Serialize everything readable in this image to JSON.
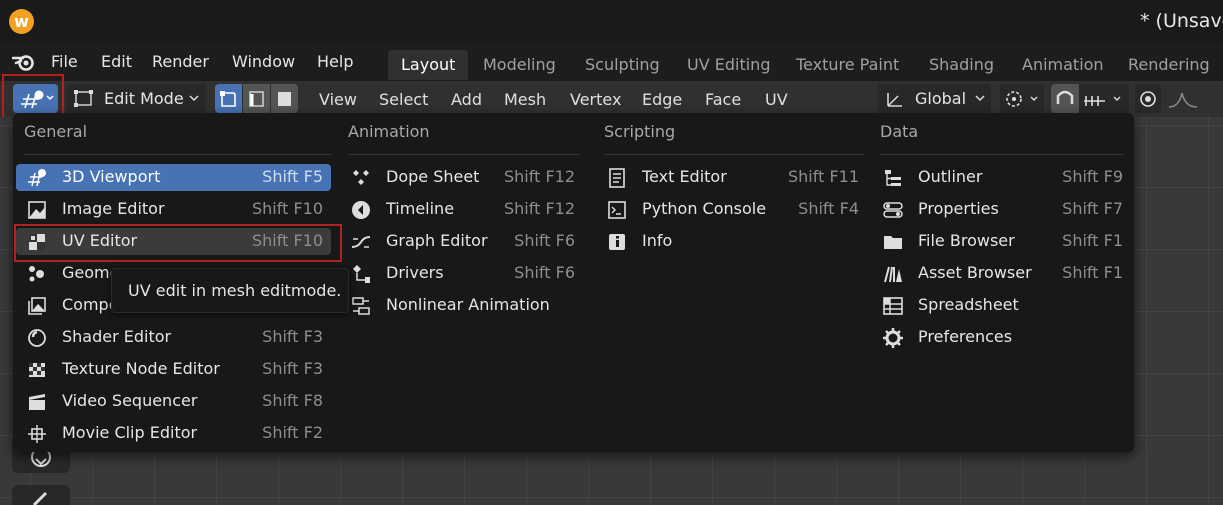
{
  "window": {
    "title": "* (Unsave"
  },
  "menubar": {
    "items": [
      "File",
      "Edit",
      "Render",
      "Window",
      "Help"
    ],
    "workspaces": [
      "Layout",
      "Modeling",
      "Sculpting",
      "UV Editing",
      "Texture Paint",
      "Shading",
      "Animation",
      "Rendering"
    ],
    "active_workspace": "Layout"
  },
  "header": {
    "mode": "Edit Mode",
    "menus": [
      "View",
      "Select",
      "Add",
      "Mesh",
      "Vertex",
      "Edge",
      "Face",
      "UV"
    ],
    "transform_orientation": "Global"
  },
  "editor_menu": {
    "columns": [
      {
        "title": "General",
        "items": [
          {
            "label": "3D Viewport",
            "shortcut": "Shift F5",
            "icon": "3d-viewport-icon",
            "state": "selected"
          },
          {
            "label": "Image Editor",
            "shortcut": "Shift F10",
            "icon": "image-editor-icon"
          },
          {
            "label": "UV Editor",
            "shortcut": "Shift F10",
            "icon": "uv-editor-icon",
            "state": "hover"
          },
          {
            "label": "Geome",
            "shortcut": "",
            "icon": "geometry-node-editor-icon"
          },
          {
            "label": "Compo",
            "shortcut": "",
            "icon": "compositor-icon"
          },
          {
            "label": "Shader Editor",
            "shortcut": "Shift F3",
            "icon": "shader-editor-icon"
          },
          {
            "label": "Texture Node Editor",
            "shortcut": "Shift F3",
            "icon": "texture-node-editor-icon"
          },
          {
            "label": "Video Sequencer",
            "shortcut": "Shift F8",
            "icon": "video-sequencer-icon"
          },
          {
            "label": "Movie Clip Editor",
            "shortcut": "Shift F2",
            "icon": "movie-clip-editor-icon"
          }
        ]
      },
      {
        "title": "Animation",
        "items": [
          {
            "label": "Dope Sheet",
            "shortcut": "Shift F12",
            "icon": "dope-sheet-icon"
          },
          {
            "label": "Timeline",
            "shortcut": "Shift F12",
            "icon": "timeline-icon"
          },
          {
            "label": "Graph Editor",
            "shortcut": "Shift F6",
            "icon": "graph-editor-icon"
          },
          {
            "label": "Drivers",
            "shortcut": "Shift F6",
            "icon": "drivers-icon"
          },
          {
            "label": "Nonlinear Animation",
            "shortcut": "",
            "icon": "nla-icon"
          }
        ]
      },
      {
        "title": "Scripting",
        "items": [
          {
            "label": "Text Editor",
            "shortcut": "Shift F11",
            "icon": "text-editor-icon"
          },
          {
            "label": "Python Console",
            "shortcut": "Shift F4",
            "icon": "python-console-icon"
          },
          {
            "label": "Info",
            "shortcut": "",
            "icon": "info-icon"
          }
        ]
      },
      {
        "title": "Data",
        "items": [
          {
            "label": "Outliner",
            "shortcut": "Shift F9",
            "icon": "outliner-icon"
          },
          {
            "label": "Properties",
            "shortcut": "Shift F7",
            "icon": "properties-icon"
          },
          {
            "label": "File Browser",
            "shortcut": "Shift F1",
            "icon": "file-browser-icon"
          },
          {
            "label": "Asset Browser",
            "shortcut": "Shift F1",
            "icon": "asset-browser-icon"
          },
          {
            "label": "Spreadsheet",
            "shortcut": "",
            "icon": "spreadsheet-icon"
          },
          {
            "label": "Preferences",
            "shortcut": "",
            "icon": "preferences-icon"
          }
        ]
      }
    ]
  },
  "tooltip": {
    "text": "UV edit in mesh editmode."
  },
  "colors": {
    "selected": "#4772b3",
    "highlight_box": "#b22222",
    "menu_bg": "#181818"
  }
}
